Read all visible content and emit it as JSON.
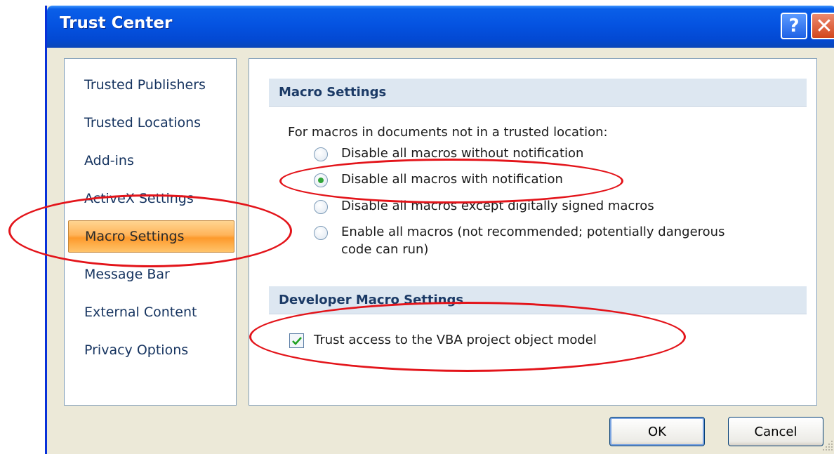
{
  "window": {
    "title": "Trust Center",
    "help_glyph": "?",
    "close_glyph": "✕"
  },
  "sidebar": {
    "items": [
      {
        "label": "Trusted Publishers",
        "selected": false
      },
      {
        "label": "Trusted Locations",
        "selected": false
      },
      {
        "label": "Add-ins",
        "selected": false
      },
      {
        "label": "ActiveX Settings",
        "selected": false
      },
      {
        "label": "Macro Settings",
        "selected": true
      },
      {
        "label": "Message Bar",
        "selected": false
      },
      {
        "label": "External Content",
        "selected": false
      },
      {
        "label": "Privacy Options",
        "selected": false
      }
    ]
  },
  "macro_settings": {
    "header": "Macro Settings",
    "intro": "For macros in documents not in a trusted location:",
    "options": [
      {
        "label": "Disable all macros without notification",
        "checked": false
      },
      {
        "label": "Disable all macros with notification",
        "checked": true
      },
      {
        "label": "Disable all macros except digitally signed macros",
        "checked": false
      },
      {
        "label_line1": "Enable all macros (not recommended; potentially dangerous",
        "label_line2": "code can run)",
        "checked": false
      }
    ]
  },
  "developer_settings": {
    "header": "Developer Macro Settings",
    "vba_label": "Trust access to the VBA project object model",
    "vba_checked": true
  },
  "buttons": {
    "ok": "OK",
    "cancel": "Cancel"
  },
  "colors": {
    "titlebar": "#0553e1",
    "selected_item": "#fd9a2c",
    "annotation_ellipse": "#e3141a",
    "section_header": "#dde7f1"
  }
}
